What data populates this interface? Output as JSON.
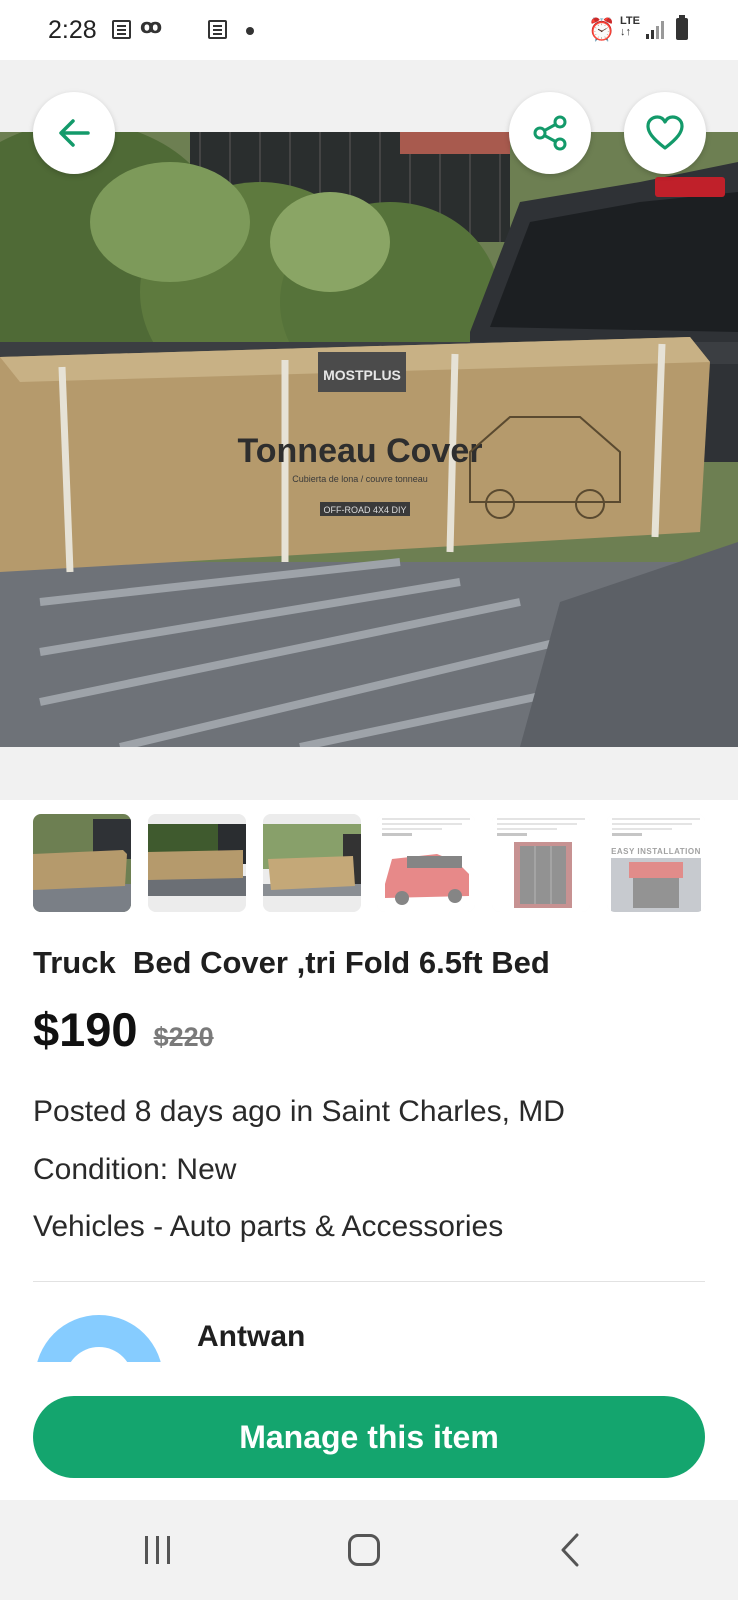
{
  "status_bar": {
    "time": "2:28",
    "voicemail": "ꝏ",
    "network": "LTE",
    "icons": [
      "news-icon",
      "voicemail-icon",
      "news-icon",
      "notification-dot-icon",
      "alarm-icon",
      "lte-icon",
      "signal-icon",
      "battery-icon"
    ]
  },
  "photo": {
    "box_brand": "MOSTPLUS",
    "box_title": "Tonneau Cover",
    "box_subtitle": "Cubierta de lona / couvre tonneau",
    "box_label": "OFF-ROAD 4X4 DIY"
  },
  "thumbnails": [
    {
      "kind": "photo",
      "caption": ""
    },
    {
      "kind": "photo",
      "caption": ""
    },
    {
      "kind": "photo",
      "caption": ""
    },
    {
      "kind": "product-red-truck",
      "caption": ""
    },
    {
      "kind": "product-bed-top",
      "caption": ""
    },
    {
      "kind": "product-installation",
      "caption": "EASY INSTALLATION"
    }
  ],
  "listing": {
    "title": "Truck  Bed Cover ,tri Fold 6.5ft Bed",
    "price": "$190",
    "original_price": "$220",
    "posted": "Posted 8 days ago in Saint Charles, MD",
    "condition": "Condition: New",
    "category": "Vehicles - Auto parts & Accessories"
  },
  "seller": {
    "name": "Antwan"
  },
  "actions": {
    "manage_label": "Manage this item"
  },
  "colors": {
    "accent": "#14a56e",
    "icon_teal": "#139a6a",
    "avatar": "#86ccff"
  }
}
